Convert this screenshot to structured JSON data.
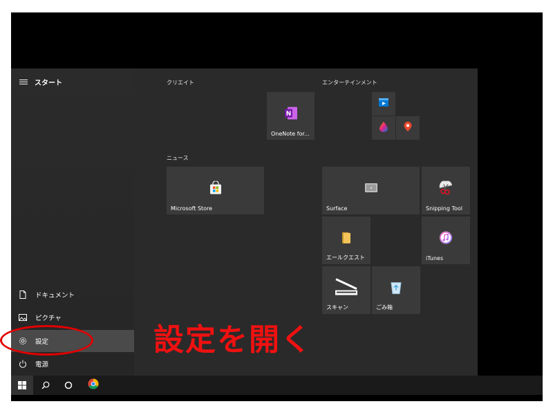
{
  "start": {
    "title": "スタート",
    "rail": {
      "documents": "ドキュメント",
      "pictures": "ピクチャ",
      "settings": "設定",
      "power": "電源"
    }
  },
  "groups": {
    "create": "クリエイト",
    "entertainment": "エンターテインメント",
    "news": "ニュース"
  },
  "tiles": {
    "onenote": "OneNote for...",
    "microsoft_store": "Microsoft Store",
    "surface": "Surface",
    "snipping_tool": "Snipping Tool",
    "mail_quest": "エールクエスト",
    "itunes": "iTunes",
    "scanner": "スキャン",
    "recycle_bin": "ごみ箱"
  },
  "annotation": {
    "text": "設定を開く",
    "color": "#ee1111"
  },
  "colors": {
    "tile_bg": "#3a3a3a",
    "rail_selected": "#4a4a4a",
    "onenote_purple": "#7719aa",
    "annotation_red": "#e00000"
  },
  "icons": {
    "menu": "hamburger-icon",
    "documents": "document-icon",
    "pictures": "picture-icon",
    "settings": "gear-icon",
    "power": "power-icon",
    "windows": "windows-logo-icon",
    "search": "search-icon",
    "cortana": "cortana-circle-icon",
    "chrome": "chrome-icon"
  }
}
